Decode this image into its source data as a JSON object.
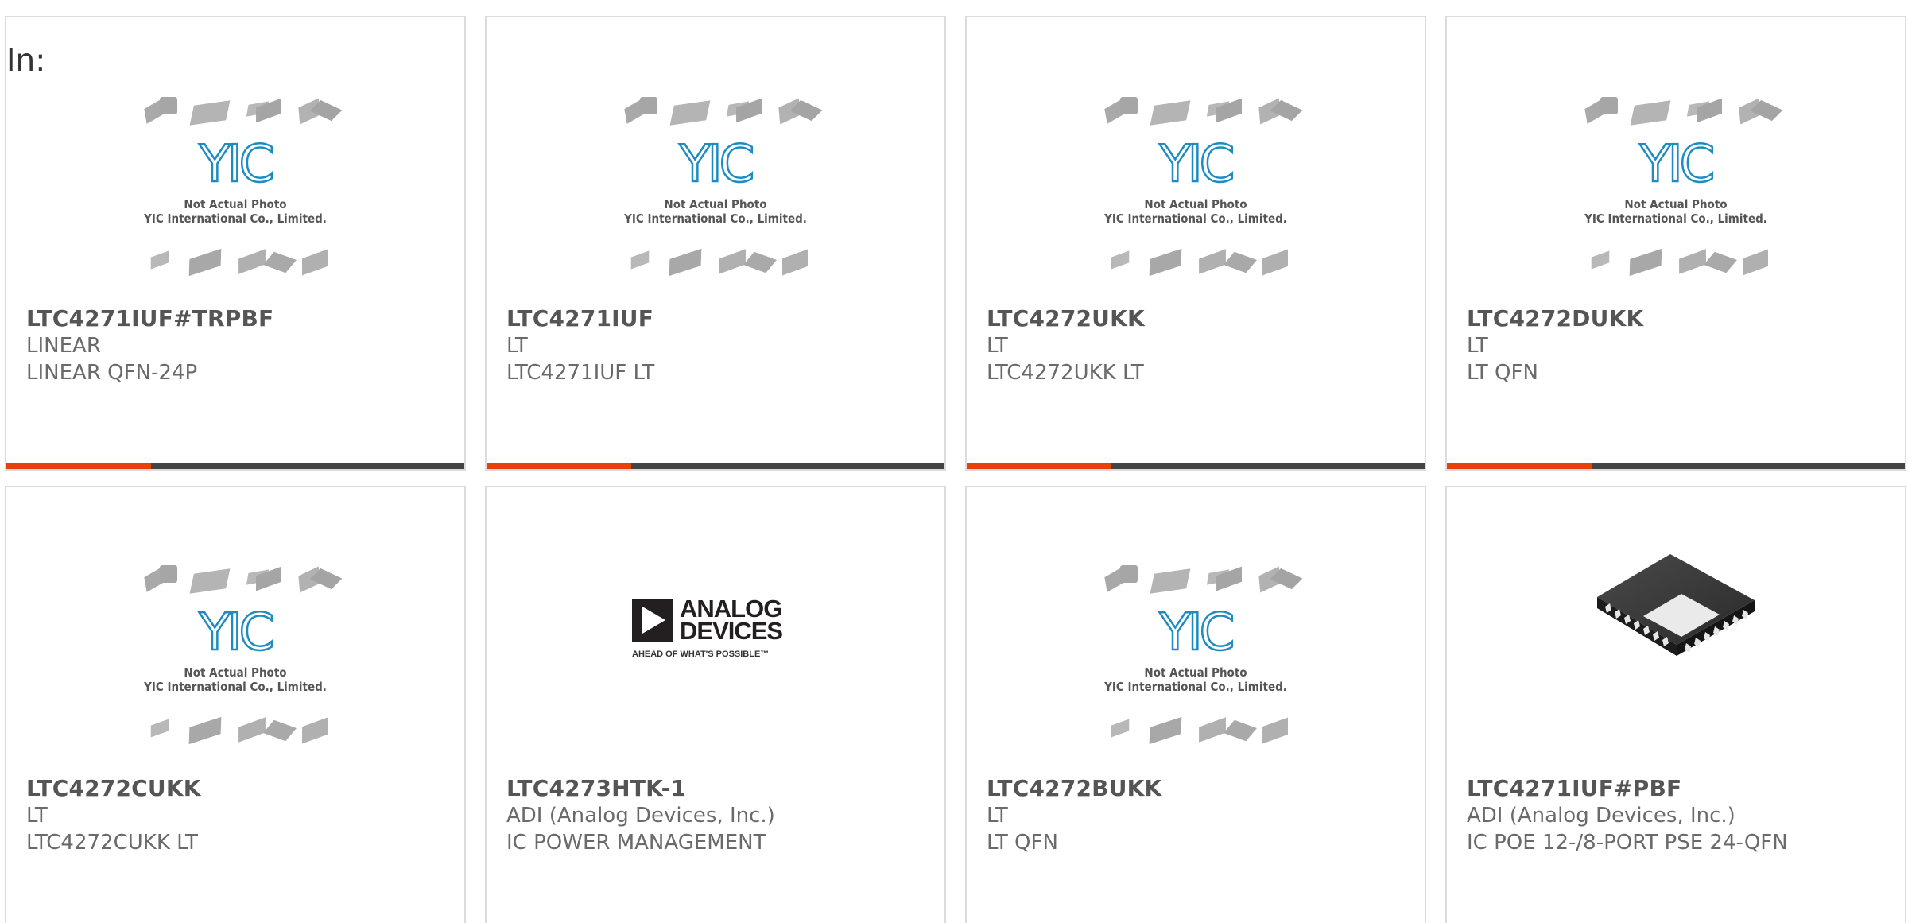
{
  "heading": "In:",
  "placeholder": {
    "logo_text": "YIC",
    "line1": "Not Actual Photo",
    "line2": "YIC International Co., Limited."
  },
  "brand_logo": {
    "name": "ANALOG DEVICES",
    "line1": "ANALOG",
    "line2": "DEVICES",
    "tagline": "AHEAD OF WHAT'S POSSIBLE™"
  },
  "colors": {
    "accent": "#e5400e",
    "bar": "#444444",
    "yic_blue": "#1e8bc3"
  },
  "products": [
    {
      "part_number": "LTC4271IUF#TRPBF",
      "manufacturer": "LINEAR",
      "description": "LINEAR QFN-24P",
      "image": "placeholder"
    },
    {
      "part_number": "LTC4271IUF",
      "manufacturer": "LT",
      "description": "LTC4271IUF LT",
      "image": "placeholder"
    },
    {
      "part_number": "LTC4272UKK",
      "manufacturer": "LT",
      "description": "LTC4272UKK LT",
      "image": "placeholder"
    },
    {
      "part_number": "LTC4272DUKK",
      "manufacturer": "LT",
      "description": "LT QFN",
      "image": "placeholder"
    },
    {
      "part_number": "LTC4272CUKK",
      "manufacturer": "LT",
      "description": "LTC4272CUKK LT",
      "image": "placeholder"
    },
    {
      "part_number": "LTC4273HTK-1",
      "manufacturer": "ADI (Analog Devices, Inc.)",
      "description": "IC POWER MANAGEMENT",
      "image": "adi-logo"
    },
    {
      "part_number": "LTC4272BUKK",
      "manufacturer": "LT",
      "description": "LT QFN",
      "image": "placeholder"
    },
    {
      "part_number": "LTC4271IUF#PBF",
      "manufacturer": "ADI (Analog Devices, Inc.)",
      "description": "IC POE 12-/8-PORT PSE 24-QFN",
      "image": "qfn-chip"
    }
  ]
}
